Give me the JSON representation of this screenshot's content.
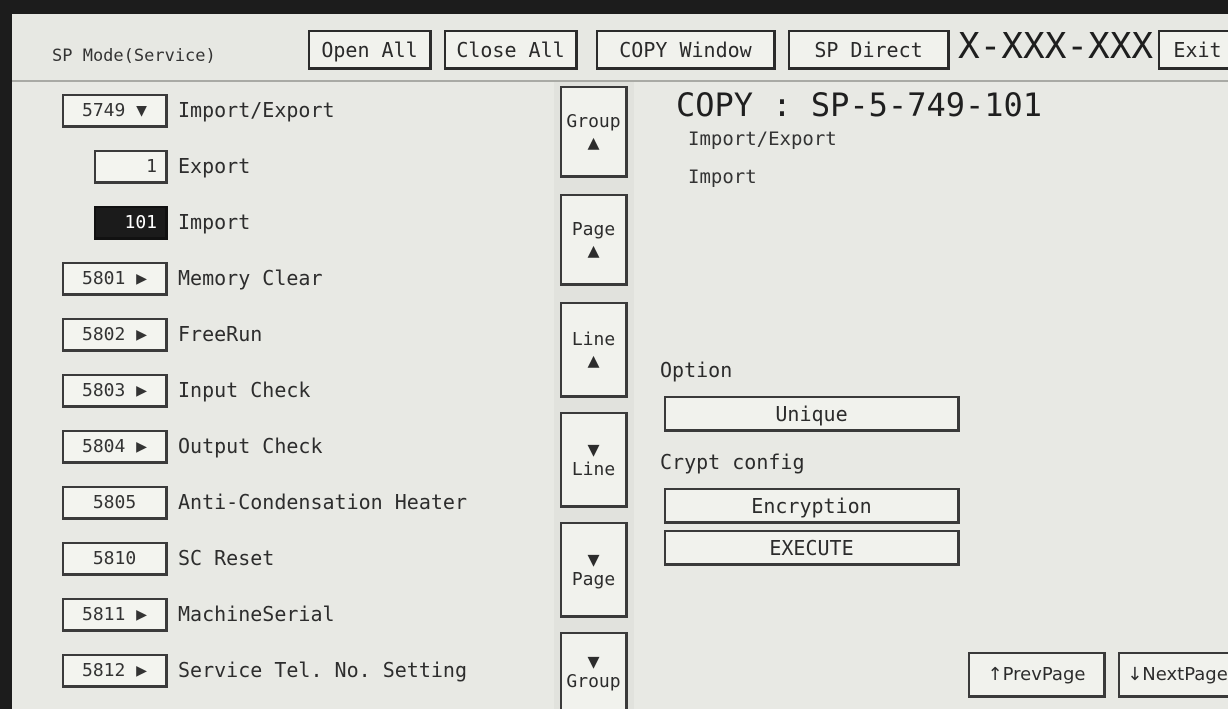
{
  "header": {
    "mode_label": "SP Mode(Service)",
    "open_all": "Open All",
    "close_all": "Close All",
    "copy_window": "COPY Window",
    "sp_direct": "SP Direct",
    "machine_id": "X-XXX-XXX",
    "exit": "Exit"
  },
  "list": [
    {
      "code": "5749 ▼",
      "label": "Import/Export"
    },
    {
      "code": "1",
      "label": "Export"
    },
    {
      "code": "101",
      "label": "Import"
    },
    {
      "code": "5801 ▶",
      "label": "Memory Clear"
    },
    {
      "code": "5802 ▶",
      "label": "FreeRun"
    },
    {
      "code": "5803 ▶",
      "label": "Input Check"
    },
    {
      "code": "5804 ▶",
      "label": "Output Check"
    },
    {
      "code": "5805",
      "label": "Anti-Condensation Heater"
    },
    {
      "code": "5810",
      "label": "SC Reset"
    },
    {
      "code": "5811 ▶",
      "label": "MachineSerial"
    },
    {
      "code": "5812 ▶",
      "label": "Service Tel. No. Setting"
    }
  ],
  "nav": {
    "group_up": "Group",
    "page_up": "Page",
    "line_up": "Line",
    "line_down": "Line",
    "page_down": "Page",
    "group_down": "Group",
    "up_arrow": "▲",
    "down_arrow": "▼"
  },
  "detail": {
    "title": "COPY : SP-5-749-101",
    "path1": "Import/Export",
    "path2": "Import",
    "option_label": "Option",
    "option_value": "Unique",
    "crypt_label": "Crypt config",
    "crypt_value": "Encryption",
    "execute": "EXECUTE"
  },
  "paging": {
    "prev": "↑PrevPage",
    "next": "↓NextPage"
  }
}
